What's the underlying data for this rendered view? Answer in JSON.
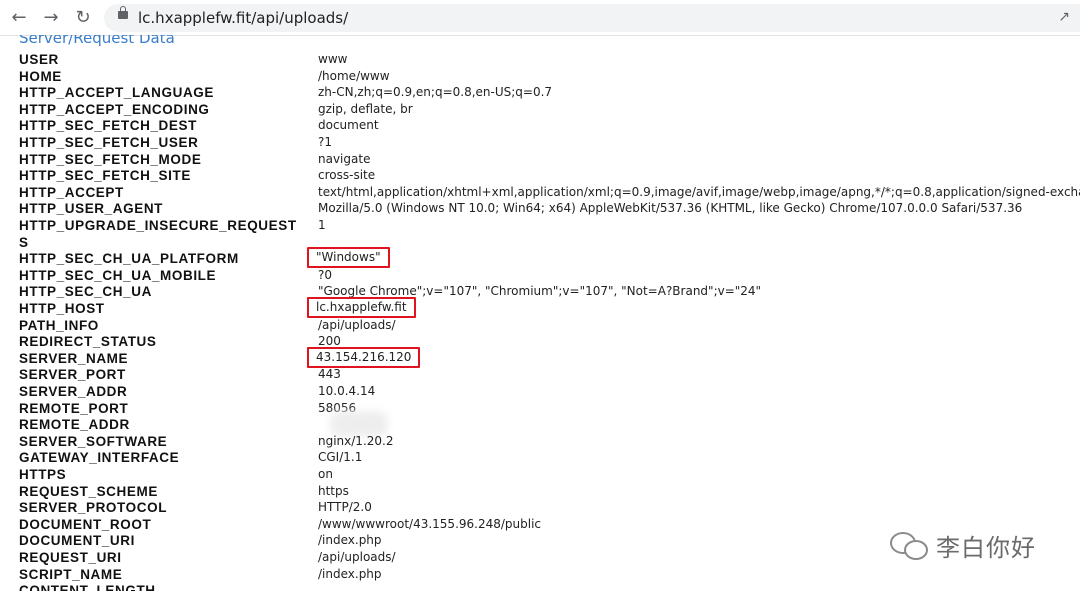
{
  "browser": {
    "url": "lc.hxapplefw.fit/api/uploads/",
    "back_icon": "arrow-left-icon",
    "forward_icon": "arrow-right-icon",
    "reload_icon": "reload-icon",
    "lock_icon": "lock-icon",
    "share_icon": "share-icon"
  },
  "page": {
    "heading": "Server/Request Data",
    "rows": [
      {
        "key": "USER",
        "value": "www"
      },
      {
        "key": "HOME",
        "value": "/home/www"
      },
      {
        "key": "HTTP_ACCEPT_LANGUAGE",
        "value": "zh-CN,zh;q=0.9,en;q=0.8,en-US;q=0.7"
      },
      {
        "key": "HTTP_ACCEPT_ENCODING",
        "value": "gzip, deflate, br"
      },
      {
        "key": "HTTP_SEC_FETCH_DEST",
        "value": "document"
      },
      {
        "key": "HTTP_SEC_FETCH_USER",
        "value": "?1"
      },
      {
        "key": "HTTP_SEC_FETCH_MODE",
        "value": "navigate"
      },
      {
        "key": "HTTP_SEC_FETCH_SITE",
        "value": "cross-site"
      },
      {
        "key": "HTTP_ACCEPT",
        "value": "text/html,application/xhtml+xml,application/xml;q=0.9,image/avif,image/webp,image/apng,*/*;q=0.8,application/signed-excha"
      },
      {
        "key": "HTTP_USER_AGENT",
        "value": "Mozilla/5.0 (Windows NT 10.0; Win64; x64) AppleWebKit/537.36 (KHTML, like Gecko) Chrome/107.0.0.0 Safari/537.36"
      },
      {
        "key": "HTTP_UPGRADE_INSECURE_REQUEST",
        "value": "1"
      },
      {
        "key": "S",
        "value": ""
      },
      {
        "key": "HTTP_SEC_CH_UA_PLATFORM",
        "value": "\"Windows\""
      },
      {
        "key": "HTTP_SEC_CH_UA_MOBILE",
        "value": "?0"
      },
      {
        "key": "HTTP_SEC_CH_UA",
        "value": "\"Google Chrome\";v=\"107\", \"Chromium\";v=\"107\", \"Not=A?Brand\";v=\"24\""
      },
      {
        "key": "HTTP_HOST",
        "value": "lc.hxapplefw.fit"
      },
      {
        "key": "PATH_INFO",
        "value": "/api/uploads/"
      },
      {
        "key": "REDIRECT_STATUS",
        "value": "200"
      },
      {
        "key": "SERVER_NAME",
        "value": "43.154.216.120"
      },
      {
        "key": "SERVER_PORT",
        "value": "443"
      },
      {
        "key": "SERVER_ADDR",
        "value": "10.0.4.14"
      },
      {
        "key": "REMOTE_PORT",
        "value": "58056"
      },
      {
        "key": "REMOTE_ADDR",
        "value": ""
      },
      {
        "key": "SERVER_SOFTWARE",
        "value": "nginx/1.20.2"
      },
      {
        "key": "GATEWAY_INTERFACE",
        "value": "CGI/1.1"
      },
      {
        "key": "HTTPS",
        "value": "on"
      },
      {
        "key": "REQUEST_SCHEME",
        "value": "https"
      },
      {
        "key": "SERVER_PROTOCOL",
        "value": "HTTP/2.0"
      },
      {
        "key": "DOCUMENT_ROOT",
        "value": "/www/wwwroot/43.155.96.248/public"
      },
      {
        "key": "DOCUMENT_URI",
        "value": "/index.php"
      },
      {
        "key": "REQUEST_URI",
        "value": "/api/uploads/"
      },
      {
        "key": "SCRIPT_NAME",
        "value": "/index.php"
      },
      {
        "key": "CONTENT_LENGTH",
        "value": ""
      }
    ]
  },
  "watermark": {
    "text": "李白你好",
    "icon": "wechat-icon"
  },
  "highlight_color": "#e0141e"
}
